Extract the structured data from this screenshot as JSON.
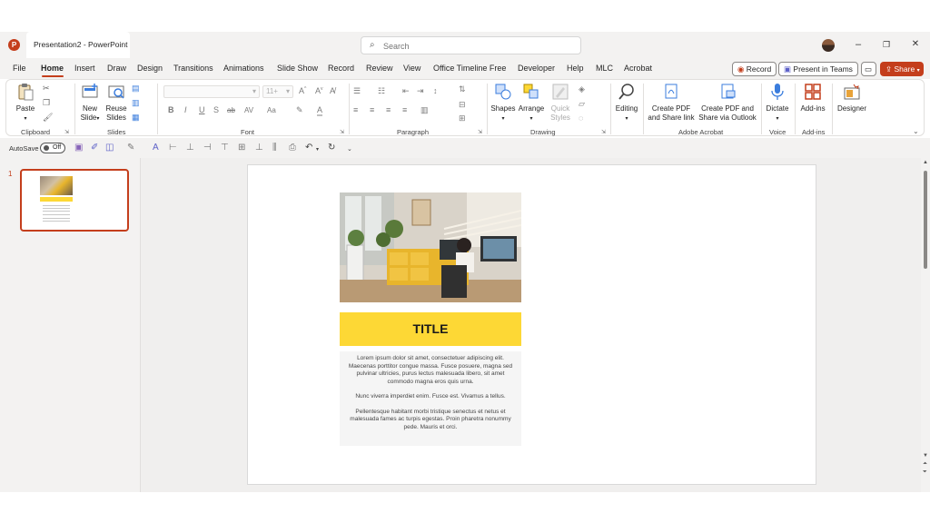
{
  "titlebar": {
    "app_icon": "powerpoint-icon",
    "document_title": "Presentation2 - PowerPoint",
    "search_placeholder": "Search",
    "minimize": "–",
    "restore": "❐",
    "close": "✕"
  },
  "menu": {
    "tabs": [
      "File",
      "Home",
      "Insert",
      "Draw",
      "Design",
      "Transitions",
      "Animations",
      "Slide Show",
      "Record",
      "Review",
      "View",
      "Office Timeline Free",
      "Developer",
      "Help",
      "MLC",
      "Acrobat"
    ],
    "active_tab": "Home",
    "record_label": "Record",
    "present_label": "Present in Teams",
    "share_label": "Share"
  },
  "ribbon": {
    "clipboard": {
      "paste": "Paste",
      "label": "Clipboard"
    },
    "slides": {
      "new_slide_line1": "New",
      "new_slide_line2": "Slide",
      "reuse_line1": "Reuse",
      "reuse_line2": "Slides",
      "label": "Slides"
    },
    "font": {
      "label": "Font"
    },
    "paragraph": {
      "label": "Paragraph"
    },
    "drawing": {
      "shapes": "Shapes",
      "arrange": "Arrange",
      "quick_line1": "Quick",
      "quick_line2": "Styles",
      "label": "Drawing"
    },
    "editing": {
      "label_btn": "Editing"
    },
    "acrobat": {
      "create_pdf_line1": "Create PDF",
      "create_pdf_line2": "and Share link",
      "create_pdf_outlook_line1": "Create PDF and",
      "create_pdf_outlook_line2": "Share via Outlook",
      "label": "Adobe Acrobat"
    },
    "voice": {
      "dictate": "Dictate",
      "label": "Voice"
    },
    "addins": {
      "btn": "Add-ins",
      "label": "Add-ins"
    },
    "designer": {
      "btn": "Designer"
    }
  },
  "qat": {
    "autosave_label": "AutoSave",
    "autosave_state": "Off"
  },
  "slides_pane": {
    "slide_number": "1"
  },
  "slide": {
    "title": "TITLE",
    "paragraphs": [
      "Lorem ipsum dolor sit amet, consectetuer adipiscing elit. Maecenas porttitor congue massa. Fusce posuere, magna sed pulvinar ultricies, purus lectus malesuada libero, sit amet commodo magna eros quis urna.",
      "Nunc viverra imperdiet enim. Fusce est. Vivamus a tellus.",
      "Pellentesque habitant morbi tristique senectus et netus et malesuada fames ac turpis egestas. Proin pharetra nonummy pede. Mauris et orci."
    ],
    "title_band_color": "#fdd835"
  },
  "colors": {
    "accent": "#c43e1c",
    "yellow": "#fdd835"
  }
}
